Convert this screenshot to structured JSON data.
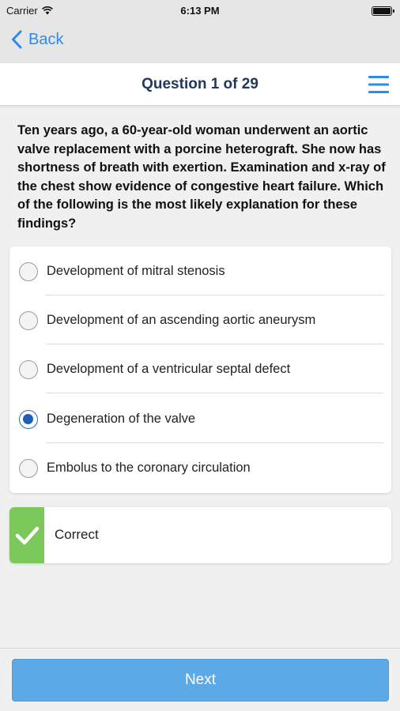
{
  "status_bar": {
    "carrier": "Carrier",
    "time": "6:13 PM",
    "wifi_icon": "wifi-icon",
    "battery_icon": "battery-icon"
  },
  "nav": {
    "back_label": "Back",
    "back_icon": "chevron-left-icon"
  },
  "header": {
    "title": "Question 1 of 29",
    "menu_icon": "hamburger-menu-icon",
    "accent_color": "#2f8ae8",
    "title_color": "#23385a"
  },
  "question": {
    "text": "Ten years ago, a 60-year-old woman underwent an aortic valve replacement with a porcine heterograft. She now has shortness of breath with exertion. Examination and x-ray of the chest show evidence of congestive heart failure. Which of the following is the most likely explanation for these findings?"
  },
  "answers": [
    {
      "label": "Development of mitral stenosis",
      "selected": false
    },
    {
      "label": "Development of an ascending aortic aneurysm",
      "selected": false
    },
    {
      "label": "Development of a ventricular septal defect",
      "selected": false
    },
    {
      "label": "Degeneration of the valve",
      "selected": true
    },
    {
      "label": "Embolus to the coronary circulation",
      "selected": false
    }
  ],
  "feedback": {
    "label": "Correct",
    "icon": "checkmark-icon",
    "color": "#7cc95b"
  },
  "footer": {
    "next_label": "Next",
    "button_color": "#5ba9e6"
  }
}
